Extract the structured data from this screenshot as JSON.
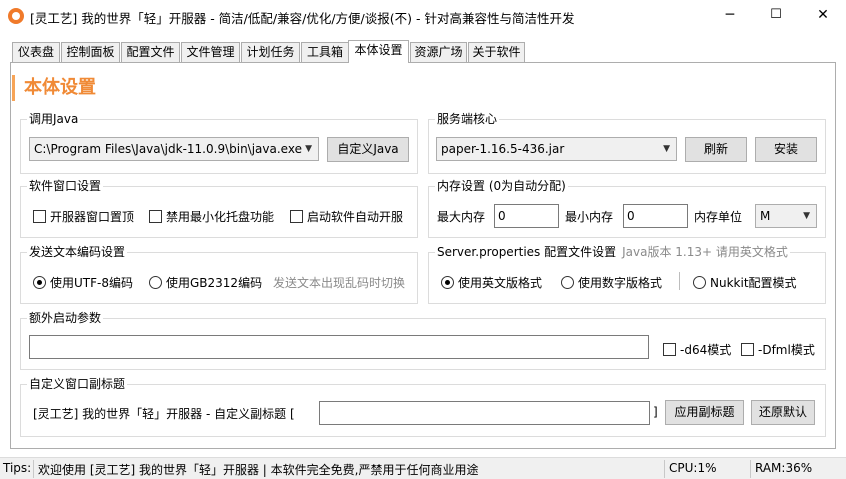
{
  "window": {
    "title": "[灵工艺] 我的世界「轻」开服器 - 简洁/低配/兼容/优化/方便/谈报(不)  - 针对高兼容性与简洁性开发",
    "minimize": "─",
    "maximize": "☐",
    "close": "✕"
  },
  "tabs": [
    "仪表盘",
    "控制面板",
    "配置文件",
    "文件管理",
    "计划任务",
    "工具箱",
    "本体设置",
    "资源广场",
    "关于软件"
  ],
  "page_title": "本体设置",
  "java": {
    "group_title": "调用Java",
    "path": "C:\\Program Files\\Java\\jdk-11.0.9\\bin\\java.exe",
    "custom_button": "自定义Java"
  },
  "core": {
    "group_title": "服务端核心",
    "selected": "paper-1.16.5-436.jar",
    "refresh_button": "刷新",
    "install_button": "安装"
  },
  "window_settings": {
    "group_title": "软件窗口设置",
    "options": [
      "开服器窗口置顶",
      "禁用最小化托盘功能",
      "启动软件自动开服"
    ]
  },
  "memory": {
    "group_title": "内存设置 (0为自动分配)",
    "max_label": "最大内存",
    "max_value": "0",
    "min_label": "最小内存",
    "min_value": "0",
    "unit_label": "内存单位",
    "unit_value": "M"
  },
  "encoding": {
    "group_title": "发送文本编码设置",
    "utf8": "使用UTF-8编码",
    "gb2312": "使用GB2312编码",
    "hint": "发送文本出现乱码时切换"
  },
  "properties": {
    "group_title": "Server.properties 配置文件设置",
    "hint": "Java版本 1.13+ 请用英文格式",
    "english": "使用英文版格式",
    "numeric": "使用数字版格式",
    "nukkit": "Nukkit配置模式"
  },
  "extra_args": {
    "group_title": "额外启动参数",
    "value": "",
    "d64": "-d64模式",
    "dfml": "-Dfml模式"
  },
  "subtitle": {
    "group_title": "自定义窗口副标题",
    "prefix": "[灵工艺] 我的世界「轻」开服器 - 自定义副标题 [",
    "value": "",
    "suffix": "]",
    "apply_button": "应用副标题",
    "reset_button": "还原默认"
  },
  "status": {
    "tips_label": "Tips:",
    "message": "欢迎使用 [灵工艺] 我的世界「轻」开服器 | 本软件完全免费,严禁用于任何商业用途",
    "cpu": "CPU:1%",
    "ram": "RAM:36%"
  }
}
